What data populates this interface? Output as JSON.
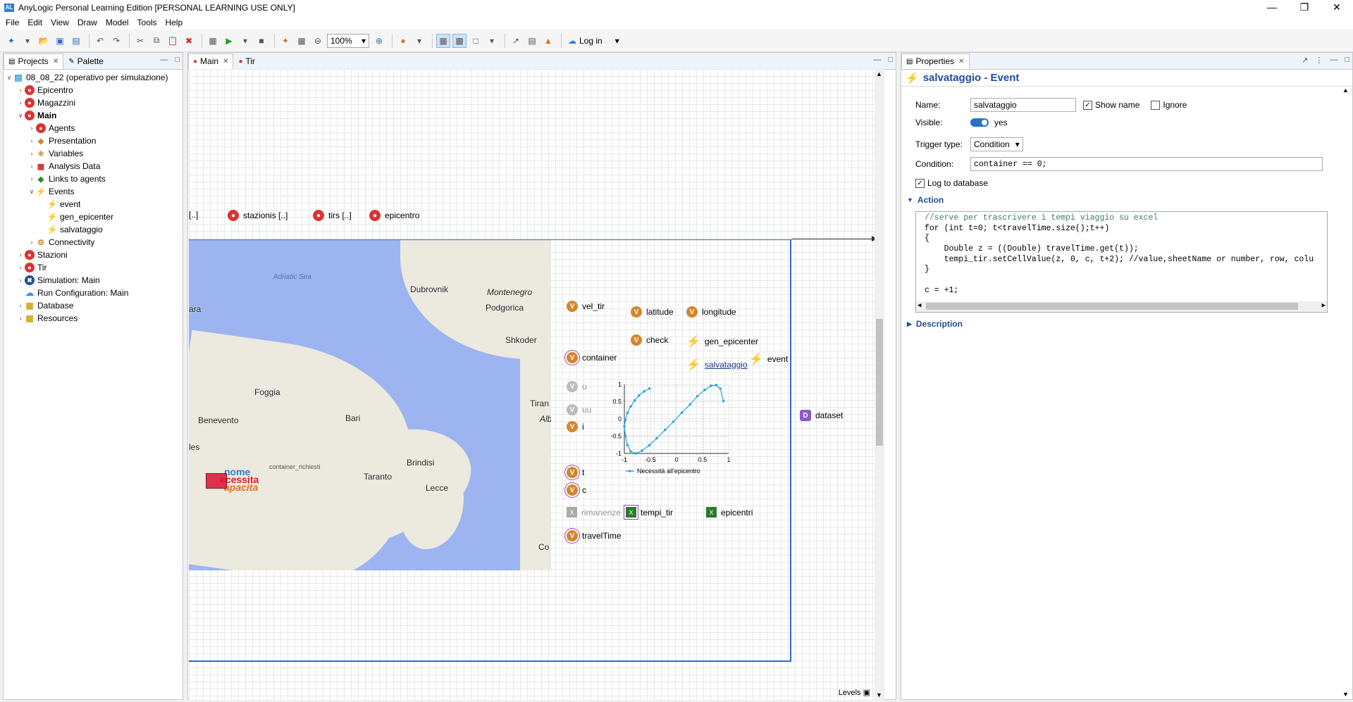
{
  "window": {
    "title": "AnyLogic Personal Learning Edition [PERSONAL LEARNING USE ONLY]"
  },
  "menu": [
    "File",
    "Edit",
    "View",
    "Draw",
    "Model",
    "Tools",
    "Help"
  ],
  "toolbar": {
    "zoom": "100%",
    "login": "Log in"
  },
  "left_panel": {
    "tabs": [
      "Projects",
      "Palette"
    ],
    "tree": [
      {
        "label": "08_08_22 (operativo per simulazione)",
        "icon": "model-icon",
        "level": 0,
        "expanded": true
      },
      {
        "label": "Epicentro",
        "icon": "agent-icon",
        "level": 1
      },
      {
        "label": "Magazzini",
        "icon": "agent-icon",
        "level": 1
      },
      {
        "label": "Main",
        "icon": "agent-icon",
        "level": 1,
        "expanded": true,
        "bold": true
      },
      {
        "label": "Agents",
        "icon": "agents-icon",
        "level": 2
      },
      {
        "label": "Presentation",
        "icon": "presentation-icon",
        "level": 2
      },
      {
        "label": "Variables",
        "icon": "variables-icon",
        "level": 2
      },
      {
        "label": "Analysis Data",
        "icon": "analysis-icon",
        "level": 2
      },
      {
        "label": "Links to agents",
        "icon": "links-icon",
        "level": 2
      },
      {
        "label": "Events",
        "icon": "events-icon",
        "level": 2,
        "expanded": true
      },
      {
        "label": "event",
        "icon": "bolt-icon",
        "level": 3
      },
      {
        "label": "gen_epicenter",
        "icon": "bolt-icon",
        "level": 3
      },
      {
        "label": "salvataggio",
        "icon": "bolt-icon",
        "level": 3
      },
      {
        "label": "Connectivity",
        "icon": "connectivity-icon",
        "level": 2
      },
      {
        "label": "Stazioni",
        "icon": "agent-icon",
        "level": 1
      },
      {
        "label": "Tir",
        "icon": "agent-icon",
        "level": 1
      },
      {
        "label": "Simulation: Main",
        "icon": "simulation-icon",
        "level": 1
      },
      {
        "label": "Run Configuration: Main",
        "icon": "cloud-icon",
        "level": 1
      },
      {
        "label": "Database",
        "icon": "folder-icon",
        "level": 1
      },
      {
        "label": "Resources",
        "icon": "folder-icon",
        "level": 1
      }
    ]
  },
  "editor": {
    "tabs": [
      "Main",
      "Tir"
    ],
    "agents_row": [
      "[..]",
      "stazionis [..]",
      "tirs [..]",
      "epicentro"
    ],
    "map": {
      "cities": [
        "Dubrovnik",
        "Montenegro",
        "Podgorica",
        "Shkoder",
        "Foggia",
        "Benevento",
        "Bari",
        "Brindisi",
        "Taranto",
        "Lecce",
        "Tiran",
        "Alb",
        "ara",
        "les",
        "Co"
      ],
      "sea": "Adriatic Sea",
      "overlay": [
        "nome",
        "ecessita",
        "apacita",
        "container_richiesti"
      ]
    },
    "elements": {
      "vel_tir": "vel_tir",
      "latitude": "latitude",
      "longitude": "longitude",
      "check": "check",
      "gen_epicenter": "gen_epicenter",
      "container": "container",
      "salvataggio": "salvataggio",
      "event": "event",
      "u": "u",
      "uu": "uu",
      "i": "i",
      "t": "t",
      "c": "c",
      "rimanenze": "rimanenze",
      "tempi_tir": "tempi_tir",
      "epicentri": "epicentri",
      "travelTime": "travelTime",
      "dataset": "dataset"
    },
    "levels": "Levels"
  },
  "chart_data": {
    "type": "scatter",
    "x_ticks": [
      "-1",
      "-0.5",
      "0",
      "0.5",
      "1"
    ],
    "y_ticks": [
      "1",
      "0.5",
      "0",
      "-0.5",
      "-1"
    ],
    "xlim": [
      -1,
      1
    ],
    "ylim": [
      -1,
      1
    ],
    "grid": true,
    "legend_position": "bottom",
    "series": [
      {
        "name": "Necessità all'epicentro",
        "color": "#29a8e0",
        "x": [
          -0.52,
          -0.62,
          -0.72,
          -0.8,
          -0.88,
          -0.94,
          -0.98,
          -1.0,
          -0.98,
          -0.94,
          -0.88,
          -0.78,
          -0.66,
          -0.52,
          -0.38,
          -0.22,
          -0.06,
          0.1,
          0.26,
          0.4,
          0.54,
          0.66,
          0.76,
          0.84,
          0.9
        ],
        "y": [
          0.88,
          0.8,
          0.68,
          0.54,
          0.36,
          0.18,
          -0.02,
          -0.22,
          -0.5,
          -0.76,
          -0.94,
          -1.0,
          -0.92,
          -0.76,
          -0.56,
          -0.32,
          -0.08,
          0.18,
          0.42,
          0.66,
          0.84,
          0.96,
          0.98,
          0.88,
          0.52
        ]
      }
    ]
  },
  "properties": {
    "tab": "Properties",
    "title": "salvataggio - Event",
    "name_label": "Name:",
    "name_value": "salvataggio",
    "show_name": "Show name",
    "ignore": "Ignore",
    "visible_label": "Visible:",
    "visible_value": "yes",
    "trigger_label": "Trigger type:",
    "trigger_value": "Condition",
    "condition_label": "Condition:",
    "condition_value": "container == 0;",
    "log_to_db": "Log to database",
    "action_section": "Action",
    "description_section": "Description",
    "code": [
      "//serve per trascrivere i tempi viaggio su excel",
      "for (int t=0; t<travelTime.size();t++)",
      "{",
      "    Double z = ((Double) travelTime.get(t));",
      "    tempi_tir.setCellValue(z, 0, c, t+2); //value,sheetName or number, row, colu",
      "}",
      "",
      "c = +1;"
    ]
  }
}
